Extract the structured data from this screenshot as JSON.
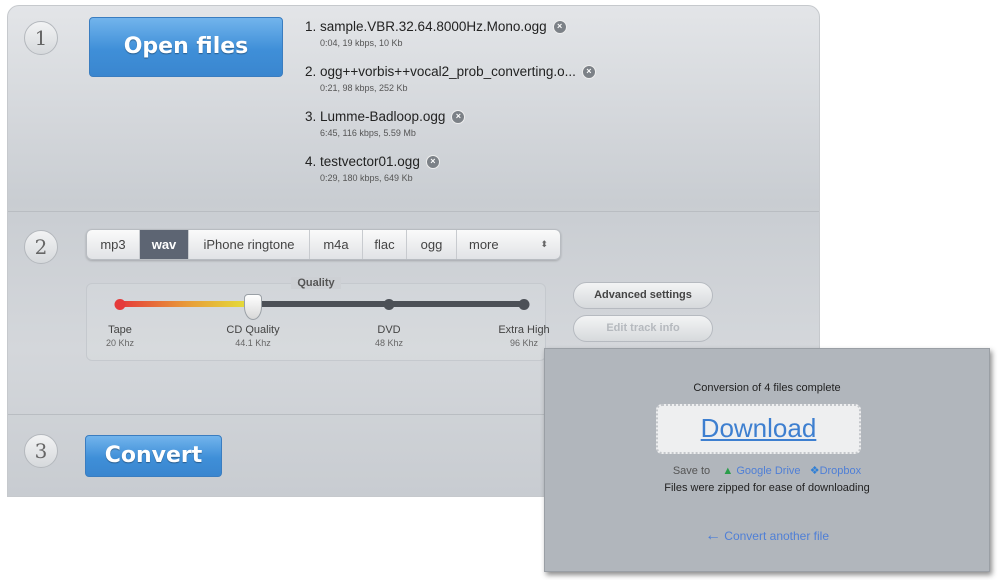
{
  "steps": [
    "1",
    "2",
    "3"
  ],
  "open_files_label": "Open files",
  "files": [
    {
      "name": "1. sample.VBR.32.64.8000Hz.Mono.ogg",
      "meta": "0:04, 19 kbps, 10 Kb"
    },
    {
      "name": "2. ogg++vorbis++vocal2_prob_converting.o...",
      "meta": "0:21, 98 kbps, 252 Kb"
    },
    {
      "name": "3. Lumme-Badloop.ogg",
      "meta": "6:45, 116 kbps, 5.59 Mb"
    },
    {
      "name": "4. testvector01.ogg",
      "meta": "0:29, 180 kbps, 649 Kb"
    }
  ],
  "formats": [
    "mp3",
    "wav",
    "iPhone ringtone",
    "m4a",
    "flac",
    "ogg",
    "more"
  ],
  "selected_format": "wav",
  "quality": {
    "label": "Quality",
    "selected_index": 1,
    "stops": [
      {
        "name": "Tape",
        "rate": "20 Khz"
      },
      {
        "name": "CD Quality",
        "rate": "44.1 Khz"
      },
      {
        "name": "DVD",
        "rate": "48 Khz"
      },
      {
        "name": "Extra High",
        "rate": "96 Khz"
      }
    ]
  },
  "advanced_settings_label": "Advanced settings",
  "edit_track_info_label": "Edit track info",
  "convert_label": "Convert",
  "popup": {
    "status": "Conversion of 4 files complete",
    "download": "Download",
    "save_to": "Save to",
    "google_drive": "Google Drive",
    "dropbox": "Dropbox",
    "note": "Files were zipped for ease of downloading",
    "convert_another": "Convert another file"
  },
  "colors": {
    "accent": "#3f8fd8",
    "link": "#4f7fd6",
    "active_tab": "#5d6573"
  }
}
